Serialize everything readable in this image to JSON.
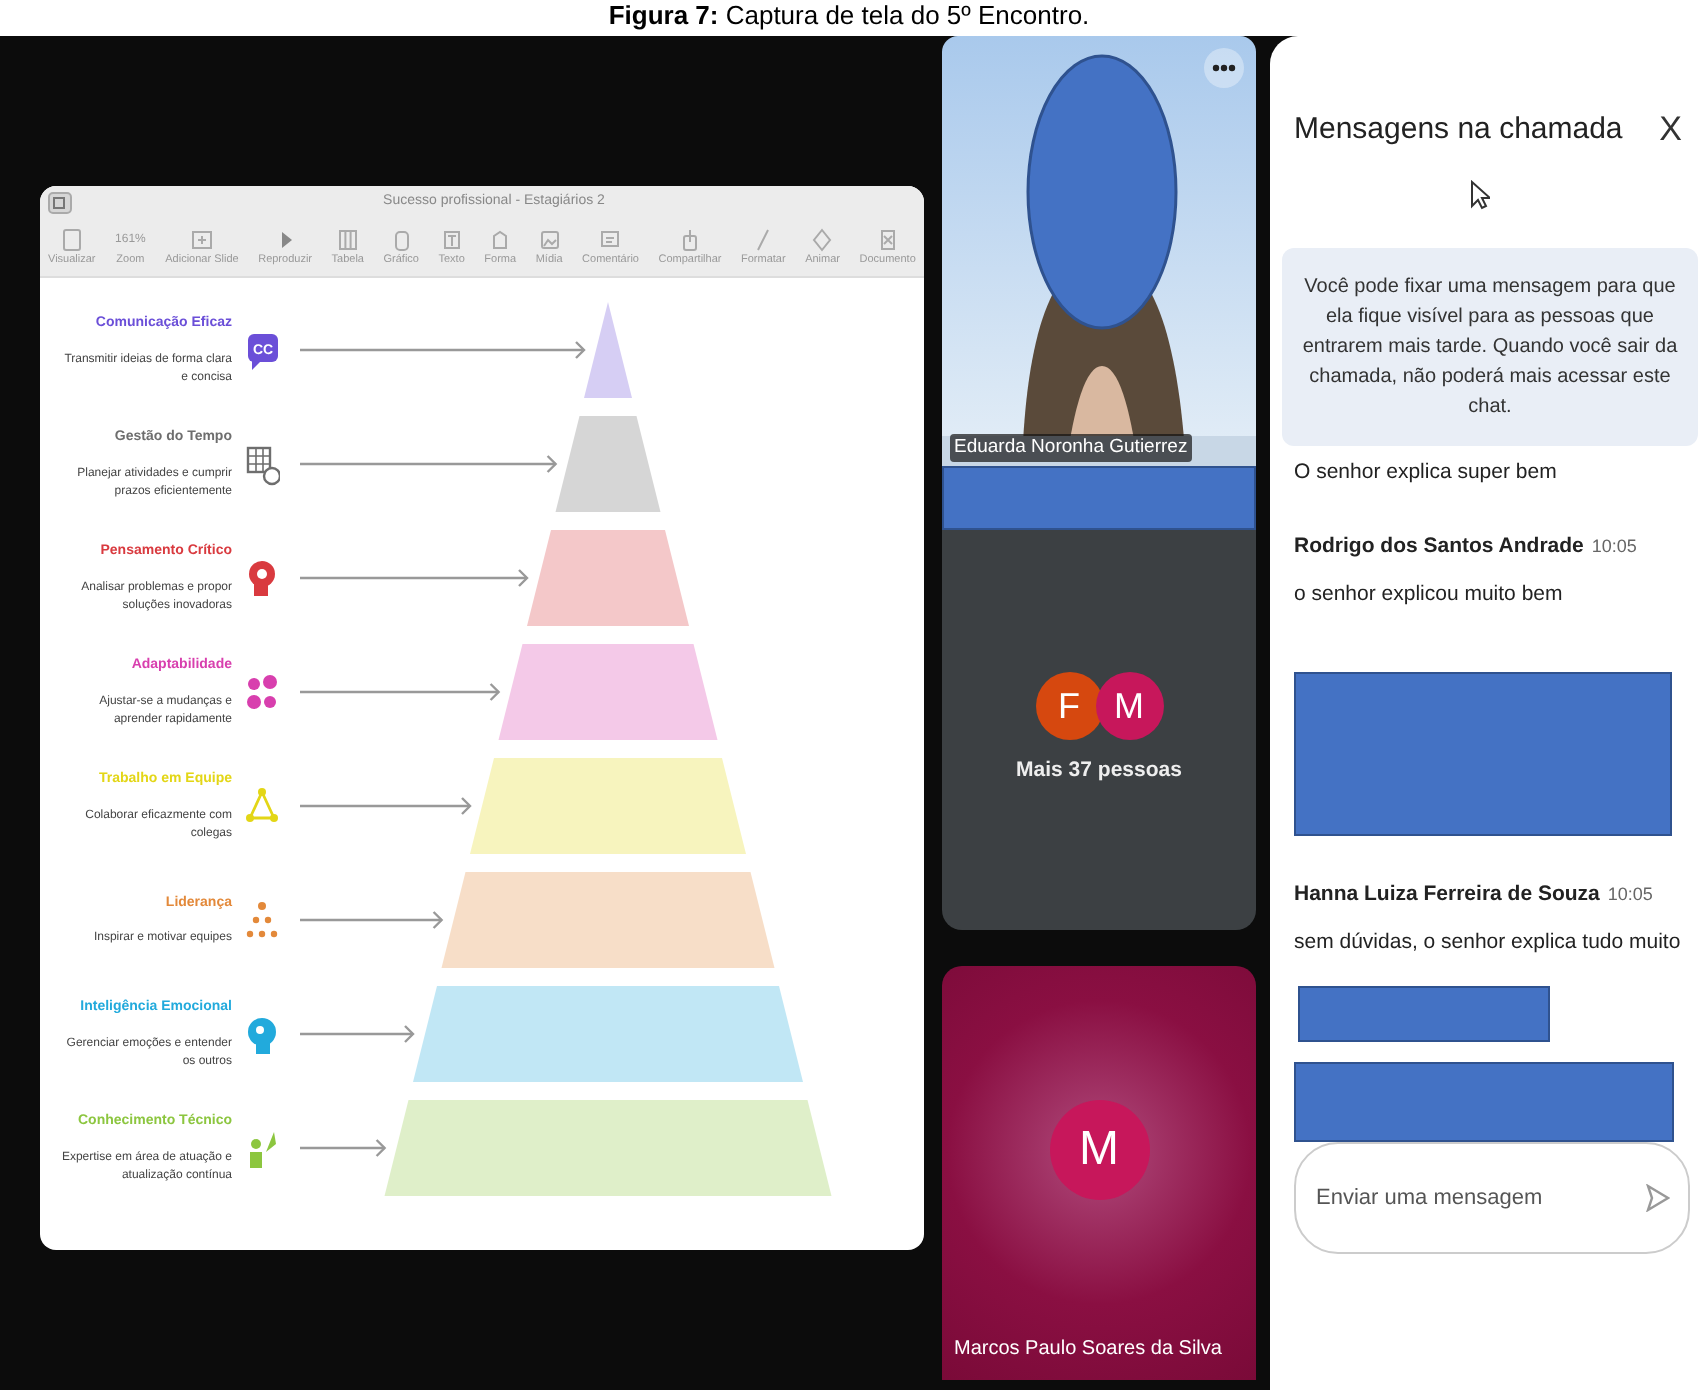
{
  "caption": "**Figura 7:** Captura de tela do 5º Encontro.",
  "slides_app": {
    "title": "Sucesso profissional - Estagiários 2",
    "toolbar": [
      {
        "label": "Visualizar"
      },
      {
        "label": "Zoom",
        "value": "161%"
      },
      {
        "label": "Adicionar Slide"
      },
      {
        "label": "Reproduzir"
      },
      {
        "label": "Tabela"
      },
      {
        "label": "Gráfico"
      },
      {
        "label": "Texto"
      },
      {
        "label": "Forma"
      },
      {
        "label": "Mídia"
      },
      {
        "label": "Comentário"
      },
      {
        "label": "Compartilhar"
      },
      {
        "label": "Formatar"
      },
      {
        "label": "Animar"
      },
      {
        "label": "Documento"
      }
    ],
    "skills": [
      {
        "title": "Comunicação Eficaz",
        "description": "Transmitir ideias de forma clara e concisa",
        "color": "#6b4fd8",
        "icon_text": "CC"
      },
      {
        "title": "Gestão do Tempo",
        "description": "Planejar atividades e cumprir prazos eficientemente",
        "color": "#6e6e6e"
      },
      {
        "title": "Pensamento Crítico",
        "description": "Analisar problemas e propor soluções inovadoras",
        "color": "#d93a3f"
      },
      {
        "title": "Adaptabilidade",
        "description": "Ajustar-se a mudanças e aprender rapidamente",
        "color": "#d83fae"
      },
      {
        "title": "Trabalho em Equipe",
        "description": "Colaborar eficazmente com colegas",
        "color": "#e3d616"
      },
      {
        "title": "Liderança",
        "description": "Inspirar e motivar equipes",
        "color": "#e3893a"
      },
      {
        "title": "Inteligência Emocional",
        "description": "Gerenciar emoções e entender os outros",
        "color": "#22aadc"
      },
      {
        "title": "Conhecimento Técnico",
        "description": "Expertise em área de atuação e atualização contínua",
        "color": "#8cc63f"
      }
    ]
  },
  "participants": {
    "video_tile": {
      "name": "Eduarda Noronha Gutierrez"
    },
    "group_tile": {
      "avatars": [
        {
          "letter": "F",
          "color": "#d6480f"
        },
        {
          "letter": "M",
          "color": "#c7175b"
        }
      ],
      "label": "Mais 37 pessoas"
    },
    "speaker_tile": {
      "avatar": {
        "letter": "M",
        "color": "#c7175b"
      },
      "name": "Marcos Paulo Soares da Silva"
    }
  },
  "chat": {
    "title": "Mensagens na chamada",
    "close": "X",
    "notice": "Você pode fixar uma mensagem para que ela fique visível para as pessoas que entrarem mais tarde. Quando você sair da chamada, não poderá mais acessar este chat.",
    "messages": [
      {
        "text": "O senhor explica super bem"
      },
      {
        "sender": "Rodrigo dos Santos Andrade",
        "time": "10:05",
        "text": "o senhor explicou muito bem"
      },
      {
        "sender": "Hanna Luiza Ferreira de Souza",
        "time": "10:05",
        "text": "sem dúvidas, o senhor explica tudo muito"
      }
    ],
    "input": {
      "placeholder": "Enviar uma mensagem"
    }
  }
}
